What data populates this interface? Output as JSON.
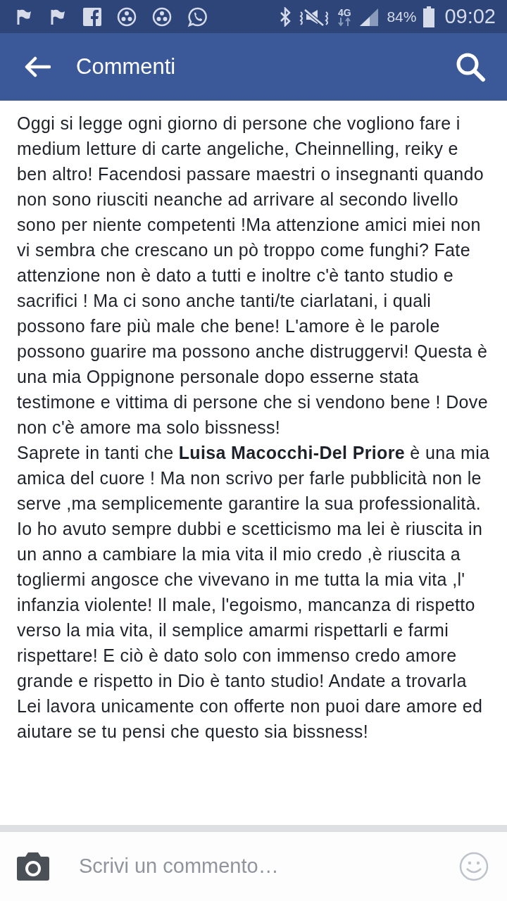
{
  "status_bar": {
    "network": "4G",
    "battery": "84%",
    "time": "09:02"
  },
  "app_bar": {
    "title": "Commenti"
  },
  "comment": {
    "paragraphs": [
      "Oggi si legge ogni giorno di persone che vogliono fare i medium letture di carte angeliche, Cheinnelling, reiky e ben altro! Facendosi passare maestri o insegnanti quando non sono riusciti neanche ad arrivare al secondo livello sono per niente competenti !Ma attenzione amici miei non vi sembra che crescano un pò troppo come funghi? Fate attenzione non è dato a tutti e inoltre c'è tanto studio e sacrifici ! Ma ci sono anche tanti/te ciarlatani, i quali possono fare più male che bene! L'amore è le parole possono guarire ma possono anche distruggervi! Questa è una mia Oppignone personale dopo esserne stata testimone e vittima di persone che si vendono bene ! Dove non c'è amore ma solo bissness!",
      "Saprete in tanti che **Luisa Macocchi-Del Priore** è una mia amica del cuore ! Ma non scrivo per farle pubblicità non le serve ,ma semplicemente garantire la sua professionalità. Io ho avuto sempre dubbi e scetticismo ma lei è riuscita in un anno a cambiare la mia vita il mio credo ,è riuscita a togliermi angosce che vivevano in me tutta la mia vita ,l' infanzia violente! Il male, l'egoismo, mancanza di rispetto verso la mia vita, il semplice amarmi rispettarli e farmi rispettare! E ciò è dato solo con immenso credo amore grande e rispetto in Dio è tanto studio! Andate a trovarla Lei lavora unicamente con offerte non puoi dare amore ed aiutare se tu pensi che questo sia bissness!"
    ]
  },
  "composer": {
    "placeholder": "Scrivi un commento…"
  }
}
